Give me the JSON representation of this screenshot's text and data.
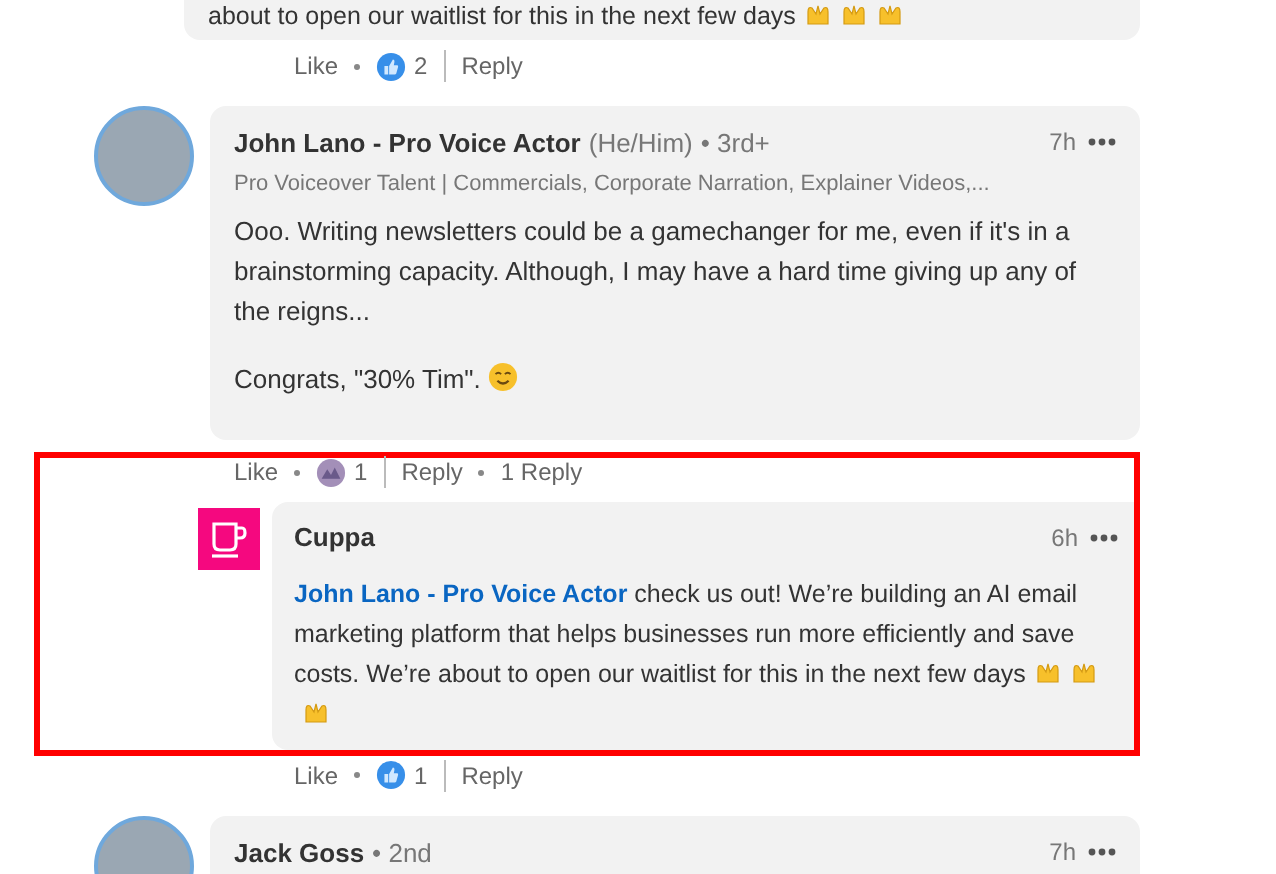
{
  "comments": [
    {
      "kind": "tail",
      "text": "about to open our waitlist for this in the next few days",
      "actions": {
        "like": "Like",
        "reaction": {
          "kind": "like",
          "count": "2"
        },
        "reply": "Reply"
      }
    },
    {
      "kind": "full",
      "author": "John Lano - Pro Voice Actor",
      "pronouns": "(He/Him)",
      "degree": "• 3rd+",
      "headline": "Pro Voiceover Talent | Commercials, Corporate Narration, Explainer Videos,...",
      "time": "7h",
      "paragraphs": [
        "Ooo. Writing newsletters could be a gamechanger for me, even if it's in a brainstorming capacity. Although, I may have a hard time giving up any of the reigns...",
        "Congrats, \"30% Tim\"."
      ],
      "actions": {
        "like": "Like",
        "reaction": {
          "kind": "mixed",
          "count": "1"
        },
        "reply": "Reply",
        "replies": "1 Reply"
      },
      "reply": {
        "author": "Cuppa",
        "time": "6h",
        "mention": "John Lano - Pro Voice Actor",
        "text": "check us out! We’re building an AI email marketing platform that helps businesses run more efficiently and save costs. We’re about to open our waitlist for this in the next few days",
        "highlighted": true,
        "actions": {
          "like": "Like",
          "reaction": {
            "kind": "like",
            "count": "1"
          },
          "reply": "Reply"
        }
      }
    },
    {
      "kind": "header",
      "author": "Jack Goss",
      "degree": "• 2nd",
      "time": "7h"
    }
  ]
}
